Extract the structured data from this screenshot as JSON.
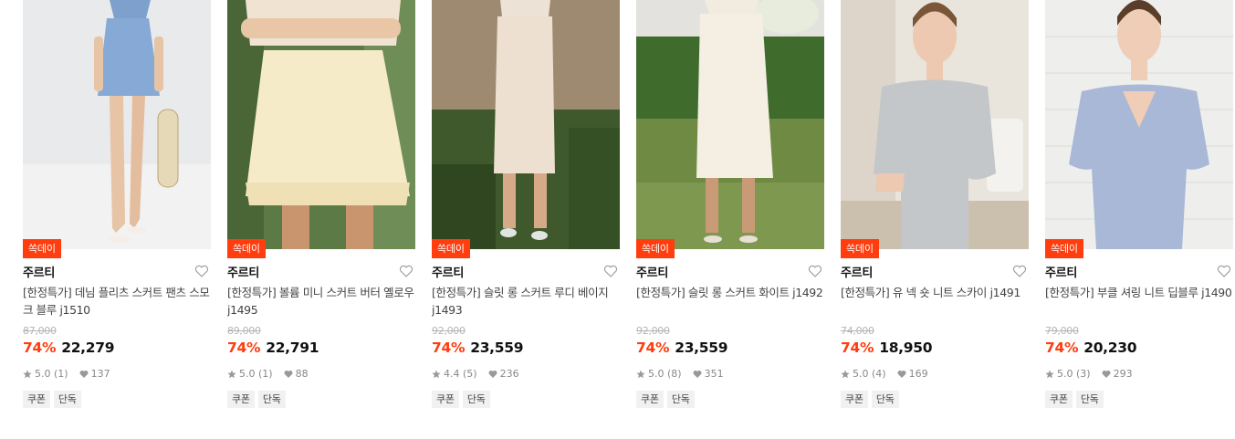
{
  "products": [
    {
      "badge": "쏙데이",
      "brand": "주르티",
      "title": "[한정특가] 데님 플리츠 스커트 팬츠 스모크 블루 j1510",
      "original_price": "87,000",
      "discount": "74%",
      "price": "22,279",
      "rating": "5.0 (1)",
      "likes": "137",
      "tags": [
        "쿠폰",
        "단독"
      ],
      "image_desc": "blue-pleated-skirt-model"
    },
    {
      "badge": "쏙데이",
      "brand": "주르티",
      "title": "[한정특가] 볼륨 미니 스커트 버터 옐로우 j1495",
      "original_price": "89,000",
      "discount": "74%",
      "price": "22,791",
      "rating": "5.0 (1)",
      "likes": "88",
      "tags": [
        "쿠폰",
        "단독"
      ],
      "image_desc": "butter-yellow-mini-skirt-model"
    },
    {
      "badge": "쏙데이",
      "brand": "주르티",
      "title": "[한정특가] 슬릿 롱 스커트 루디 베이지 j1493",
      "original_price": "92,000",
      "discount": "74%",
      "price": "23,559",
      "rating": "4.4 (5)",
      "likes": "236",
      "tags": [
        "쿠폰",
        "단독"
      ],
      "image_desc": "beige-long-skirt-model"
    },
    {
      "badge": "쏙데이",
      "brand": "주르티",
      "title": "[한정특가] 슬릿 롱 스커트 화이트 j1492",
      "original_price": "92,000",
      "discount": "74%",
      "price": "23,559",
      "rating": "5.0 (8)",
      "likes": "351",
      "tags": [
        "쿠폰",
        "단독"
      ],
      "image_desc": "white-long-skirt-model"
    },
    {
      "badge": "쏙데이",
      "brand": "주르티",
      "title": "[한정특가] 유 넥 숏 니트 스카이 j1491",
      "original_price": "74,000",
      "discount": "74%",
      "price": "18,950",
      "rating": "5.0 (4)",
      "likes": "169",
      "tags": [
        "쿠폰",
        "단독"
      ],
      "image_desc": "grey-knit-top-model"
    },
    {
      "badge": "쏙데이",
      "brand": "주르티",
      "title": "[한정특가] 부클 셔링 니트 딥블루 j1490",
      "original_price": "79,000",
      "discount": "74%",
      "price": "20,230",
      "rating": "5.0 (3)",
      "likes": "293",
      "tags": [
        "쿠폰",
        "단독"
      ],
      "image_desc": "blue-shirring-knit-model"
    }
  ],
  "colors": {
    "accent": "#ff3d0e",
    "text": "#111111",
    "muted": "#888888",
    "strike": "#b5b5b5"
  }
}
